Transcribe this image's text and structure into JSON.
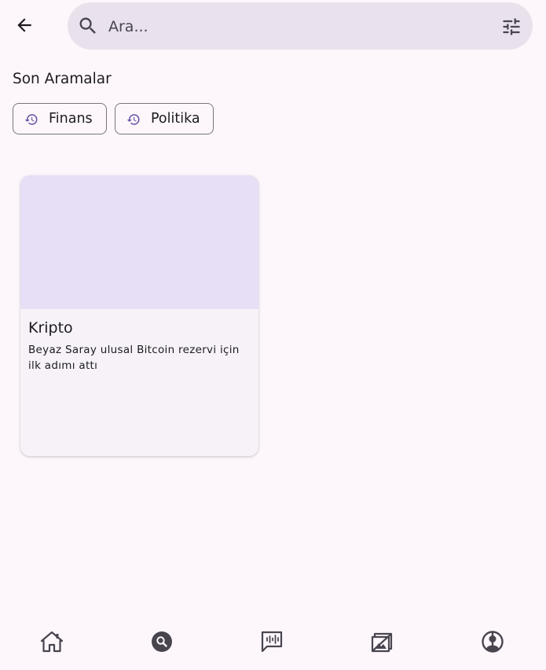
{
  "header": {
    "search": {
      "placeholder": "Ara..."
    }
  },
  "recent": {
    "title": "Son Aramalar",
    "chips": [
      "Finans",
      "Politika"
    ]
  },
  "cards": [
    {
      "title": "Kripto",
      "description": "Beyaz Saray ulusal Bitcoin rezervi için ilk adımı attı"
    }
  ],
  "nav": {
    "items": [
      "home-icon",
      "search-icon",
      "podcast-icon",
      "news-icon",
      "profile-icon"
    ],
    "active": "search-icon"
  },
  "colors": {
    "background": "#fdf7fc",
    "search_bar": "#e9e1ec",
    "card_image": "#e7dff6",
    "card_bg": "#f6f2f7",
    "accent": "#6750a4",
    "icon": "#49454f"
  }
}
